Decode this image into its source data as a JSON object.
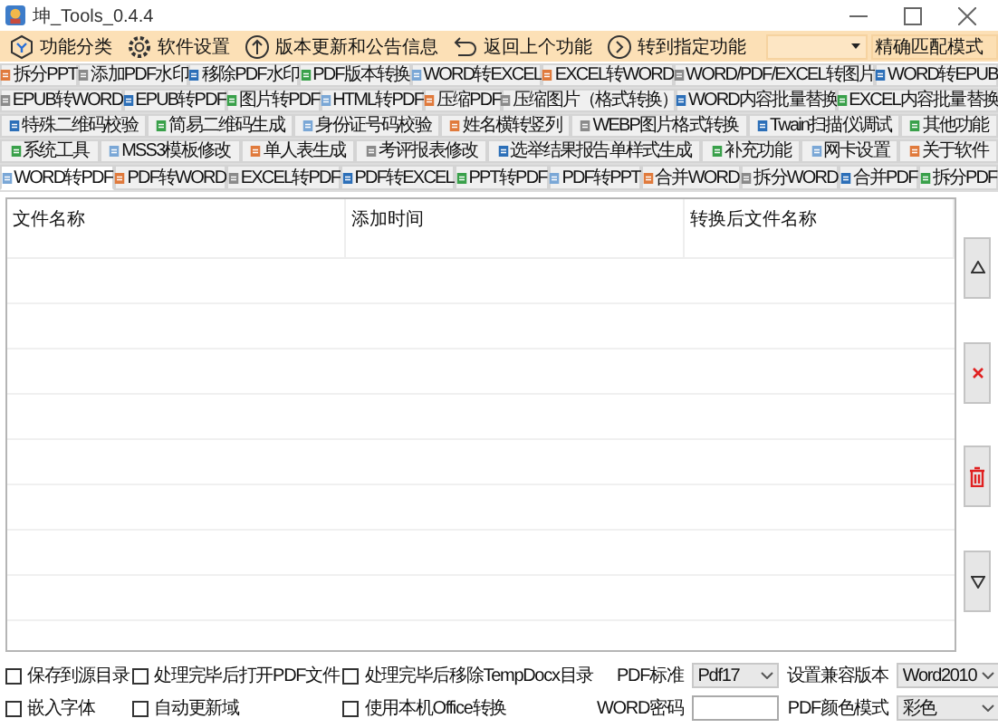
{
  "window": {
    "title": "坤_Tools_0.4.4"
  },
  "toolbar": {
    "buttons": [
      {
        "label": "功能分类",
        "kind": "category"
      },
      {
        "label": "软件设置",
        "kind": "settings"
      },
      {
        "label": "版本更新和公告信息",
        "kind": "update"
      },
      {
        "label": "返回上个功能",
        "kind": "back"
      },
      {
        "label": "转到指定功能",
        "kind": "goto"
      }
    ],
    "mode_select": {
      "value": "精确匹配模式"
    }
  },
  "tab_rows": [
    {
      "tabs": [
        {
          "label": "拆分PPT",
          "selected": false
        },
        {
          "label": "添加PDF水印",
          "selected": false
        },
        {
          "label": "移除PDF水印",
          "selected": false
        },
        {
          "label": "PDF版本转换",
          "selected": false
        },
        {
          "label": "WORD转EXCEL",
          "selected": false
        },
        {
          "label": "EXCEL转WORD",
          "selected": false
        },
        {
          "label": "WORD/PDF/EXCEL转图片",
          "selected": false
        },
        {
          "label": "WORD转EPUB",
          "selected": false
        }
      ]
    },
    {
      "tabs": [
        {
          "label": "EPUB转WORD",
          "selected": false
        },
        {
          "label": "EPUB转PDF",
          "selected": false
        },
        {
          "label": "图片转PDF",
          "selected": false
        },
        {
          "label": "HTML转PDF",
          "selected": false
        },
        {
          "label": "压缩PDF",
          "selected": false
        },
        {
          "label": "压缩图片（格式转换）",
          "selected": false
        },
        {
          "label": "WORD内容批量替换",
          "selected": false
        },
        {
          "label": "EXCEL内容批量替换",
          "selected": false
        }
      ]
    },
    {
      "tabs": [
        {
          "label": "特殊二维码校验",
          "selected": false
        },
        {
          "label": "简易二维码生成",
          "selected": false
        },
        {
          "label": "身份证号码校验",
          "selected": false
        },
        {
          "label": "姓名横转竖列",
          "selected": false
        },
        {
          "label": "WEBP图片格式转换",
          "selected": false
        },
        {
          "label": "Twain扫描仪调试",
          "selected": false
        },
        {
          "label": "其他功能",
          "selected": false
        }
      ]
    },
    {
      "tabs": [
        {
          "label": "系统工具",
          "selected": false
        },
        {
          "label": "MSS3模板修改",
          "selected": false
        },
        {
          "label": "单人表生成",
          "selected": false
        },
        {
          "label": "考评报表修改",
          "selected": false
        },
        {
          "label": "选举结果报告单样式生成",
          "selected": false
        },
        {
          "label": "补充功能",
          "selected": false
        },
        {
          "label": "网卡设置",
          "selected": false
        },
        {
          "label": "关于软件",
          "selected": false
        }
      ]
    },
    {
      "tabs": [
        {
          "label": "WORD转PDF",
          "selected": true
        },
        {
          "label": "PDF转WORD",
          "selected": false
        },
        {
          "label": "EXCEL转PDF",
          "selected": false
        },
        {
          "label": "PDF转EXCEL",
          "selected": false
        },
        {
          "label": "PPT转PDF",
          "selected": false
        },
        {
          "label": "PDF转PPT",
          "selected": false
        },
        {
          "label": "合并WORD",
          "selected": false
        },
        {
          "label": "拆分WORD",
          "selected": false
        },
        {
          "label": "合并PDF",
          "selected": false
        },
        {
          "label": "拆分PDF",
          "selected": false
        }
      ]
    }
  ],
  "file_table": {
    "columns": [
      "文件名称",
      "添加时间",
      "转换后文件名称"
    ]
  },
  "options": [
    {
      "label": "保存到源目录",
      "checked": false
    },
    {
      "label": "处理完毕后打开PDF文件",
      "checked": false
    },
    {
      "label": "处理完毕后移除TempDocx目录",
      "checked": false
    },
    {
      "label": "嵌入字体",
      "checked": false
    },
    {
      "label": "自动更新域",
      "checked": false
    },
    {
      "label": "使用本机Office转换",
      "checked": false
    }
  ],
  "pdf_standard": {
    "label": "PDF标准",
    "value": "Pdf17"
  },
  "compat_version": {
    "label": "设置兼容版本",
    "value": "Word2010"
  },
  "word_password": {
    "label": "WORD密码"
  },
  "pdf_color_mode": {
    "label": "PDF颜色模式",
    "value": "彩色"
  }
}
